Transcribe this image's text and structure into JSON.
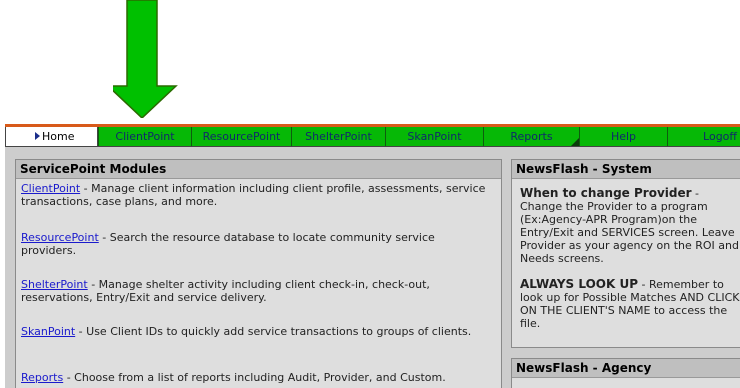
{
  "colors": {
    "arrow": "#00c000",
    "tab_green": "#06b806",
    "tab_border_top": "#d85a1a",
    "link": "#1a1acc"
  },
  "tabs": [
    {
      "label": "Home",
      "active": true,
      "icon": "play-triangle-icon"
    },
    {
      "label": "ClientPoint"
    },
    {
      "label": "ResourcePoint"
    },
    {
      "label": "ShelterPoint"
    },
    {
      "label": "SkanPoint"
    },
    {
      "label": "Reports"
    },
    {
      "label": "Help"
    },
    {
      "label": "Logoff"
    }
  ],
  "modules": {
    "title": "ServicePoint Modules",
    "items": [
      {
        "link": "ClientPoint",
        "text": " - Manage client information including client profile, assessments, service transactions, case plans, and more."
      },
      {
        "link": "ResourcePoint",
        "text": " - Search the resource database to locate community service providers."
      },
      {
        "link": "ShelterPoint",
        "text": " - Manage shelter activity including client check-in, check-out, reservations, Entry/Exit and service delivery."
      },
      {
        "link": "SkanPoint",
        "text": " - Use Client IDs to quickly add service transactions to groups of clients."
      },
      {
        "link": "Reports",
        "text": " - Choose from a list of reports including Audit, Provider, and Custom."
      }
    ]
  },
  "newsflash_system": {
    "title": "NewsFlash - System",
    "items": [
      {
        "bold": "When to change Provider",
        "text": " - Change the Provider to a program (Ex:Agency-APR Program)on the Entry/Exit and SERVICES screen. Leave Provider as your agency on the ROI and Needs screens."
      },
      {
        "bold": "ALWAYS LOOK UP",
        "text": " - Remember to look up for Possible Matches AND CLICK ON THE CLIENT'S NAME to access the file."
      }
    ]
  },
  "newsflash_agency": {
    "title": "NewsFlash - Agency"
  }
}
